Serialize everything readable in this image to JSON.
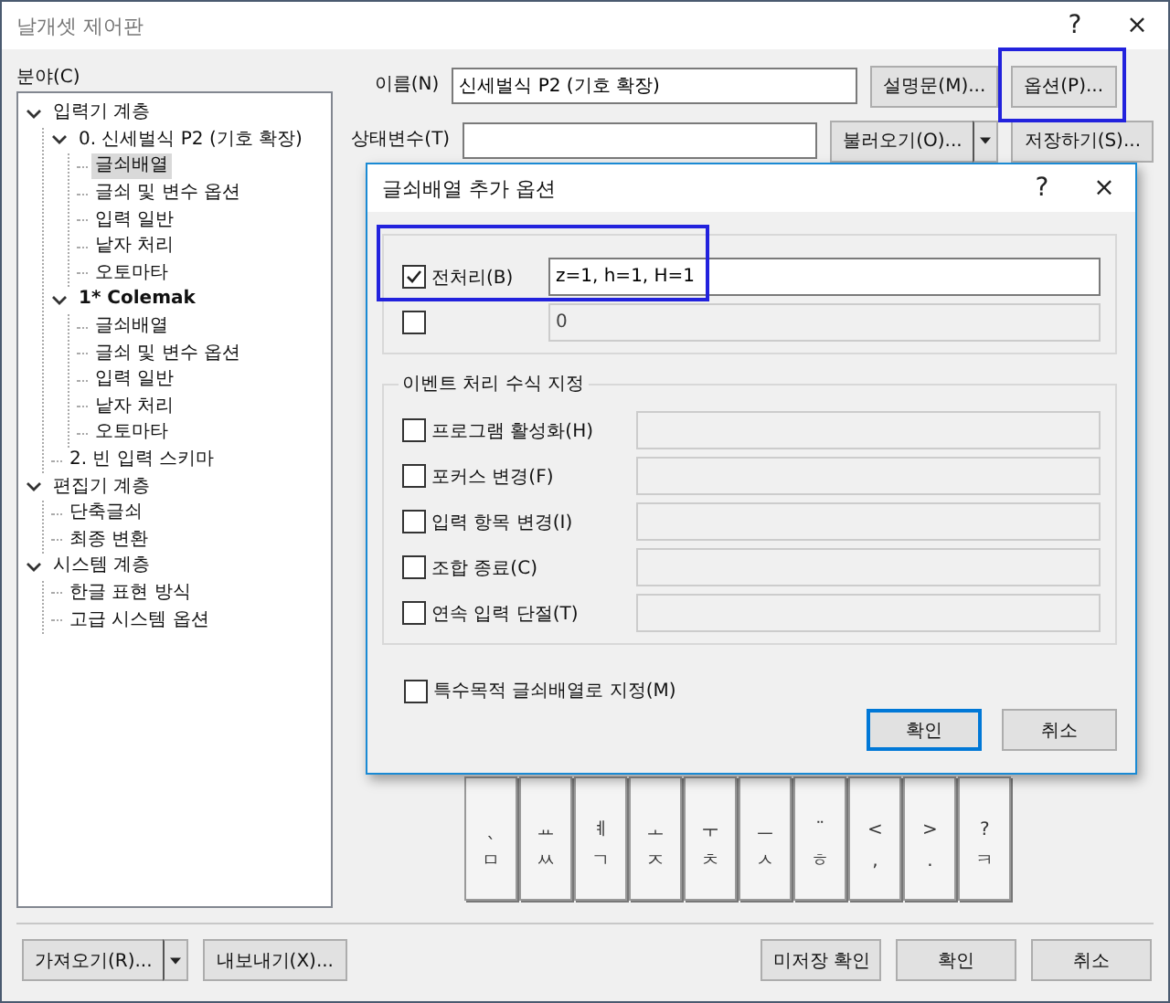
{
  "window": {
    "title": "날개셋 제어판",
    "help": "?",
    "close": "×"
  },
  "sidebar": {
    "label": "분야(C)",
    "tree": [
      {
        "label": "입력기 계층",
        "expanded": true,
        "selected": false,
        "active": false,
        "children": [
          {
            "label": "0. 신세벌식 P2 (기호 확장)",
            "expanded": true,
            "selected": false,
            "active": false,
            "children": [
              {
                "label": "글쇠배열",
                "selected": true,
                "active": false
              },
              {
                "label": "글쇠 및 변수 옵션",
                "selected": false,
                "active": false
              },
              {
                "label": "입력 일반",
                "selected": false,
                "active": false
              },
              {
                "label": "낱자 처리",
                "selected": false,
                "active": false
              },
              {
                "label": "오토마타",
                "selected": false,
                "active": false
              }
            ]
          },
          {
            "label": "1* Colemak",
            "expanded": true,
            "selected": false,
            "active": true,
            "children": [
              {
                "label": "글쇠배열",
                "selected": false,
                "active": false
              },
              {
                "label": "글쇠 및 변수 옵션",
                "selected": false,
                "active": false
              },
              {
                "label": "입력 일반",
                "selected": false,
                "active": false
              },
              {
                "label": "낱자 처리",
                "selected": false,
                "active": false
              },
              {
                "label": "오토마타",
                "selected": false,
                "active": false
              }
            ]
          },
          {
            "label": "2. 빈 입력 스키마",
            "selected": false,
            "active": false
          }
        ]
      },
      {
        "label": "편집기 계층",
        "expanded": true,
        "selected": false,
        "active": false,
        "children": [
          {
            "label": "단축글쇠",
            "selected": false,
            "active": false
          },
          {
            "label": "최종 변환",
            "selected": false,
            "active": false
          }
        ]
      },
      {
        "label": "시스템 계층",
        "expanded": true,
        "selected": false,
        "active": false,
        "children": [
          {
            "label": "한글 표현 방식",
            "selected": false,
            "active": false
          },
          {
            "label": "고급 시스템 옵션",
            "selected": false,
            "active": false
          }
        ]
      }
    ]
  },
  "name_field": {
    "label": "이름(N)",
    "value": "신세벌식 P2 (기호 확장)"
  },
  "description_button": {
    "label": "설명문(M)..."
  },
  "options_button": {
    "label": "옵션(P)...",
    "highlighted": true
  },
  "state_field": {
    "label": "상태변수(T)"
  },
  "load_button": {
    "label": "불러오기(O)..."
  },
  "save_button": {
    "label": "저장하기(S)..."
  },
  "keys": [
    {
      "upper": "ˎ",
      "lower": "ㅁ"
    },
    {
      "upper": "ㅛ",
      "lower": "ㅆ"
    },
    {
      "upper": "ㅖ",
      "lower": "ㄱ"
    },
    {
      "upper": "ㅗ",
      "lower": "ㅈ"
    },
    {
      "upper": "ㅜ",
      "lower": "ㅊ"
    },
    {
      "upper": "ㅡ",
      "lower": "ㅅ"
    },
    {
      "upper": "¨",
      "lower": "ㅎ"
    },
    {
      "upper": "<",
      "lower": ","
    },
    {
      "upper": ">",
      "lower": "."
    },
    {
      "upper": "?",
      "lower": "ㅋ"
    }
  ],
  "footer": {
    "import_button": "가져오기(R)...",
    "export_button": "내보내기(X)...",
    "buttons": [
      "미저장 확인",
      "확인",
      "취소"
    ]
  },
  "dialog": {
    "title": "글쇠배열 추가 옵션",
    "help": "?",
    "close": "×",
    "common_group": {
      "highlighted": true,
      "rows": [
        {
          "label": "전처리(B)",
          "checked": true,
          "disabled": false,
          "value": "z=1, h=1, H=1"
        },
        {
          "checked": false,
          "disabled": true,
          "value": "0"
        }
      ]
    },
    "event_group": {
      "title": "이벤트 처리 수식 지정",
      "rows": [
        {
          "label": "프로그램 활성화(H)",
          "checked": false
        },
        {
          "label": "포커스 변경(F)",
          "checked": false
        },
        {
          "label": "입력 항목 변경(I)",
          "checked": false
        },
        {
          "label": "조합 종료(C)",
          "checked": false
        },
        {
          "label": "연속 입력 단절(T)",
          "checked": false
        }
      ]
    },
    "special": {
      "label": "특수목적 글쇠배열로 지정(M)",
      "checked": false
    },
    "buttons": [
      {
        "label": "확인",
        "default": true
      },
      {
        "label": "취소",
        "default": false
      }
    ]
  }
}
